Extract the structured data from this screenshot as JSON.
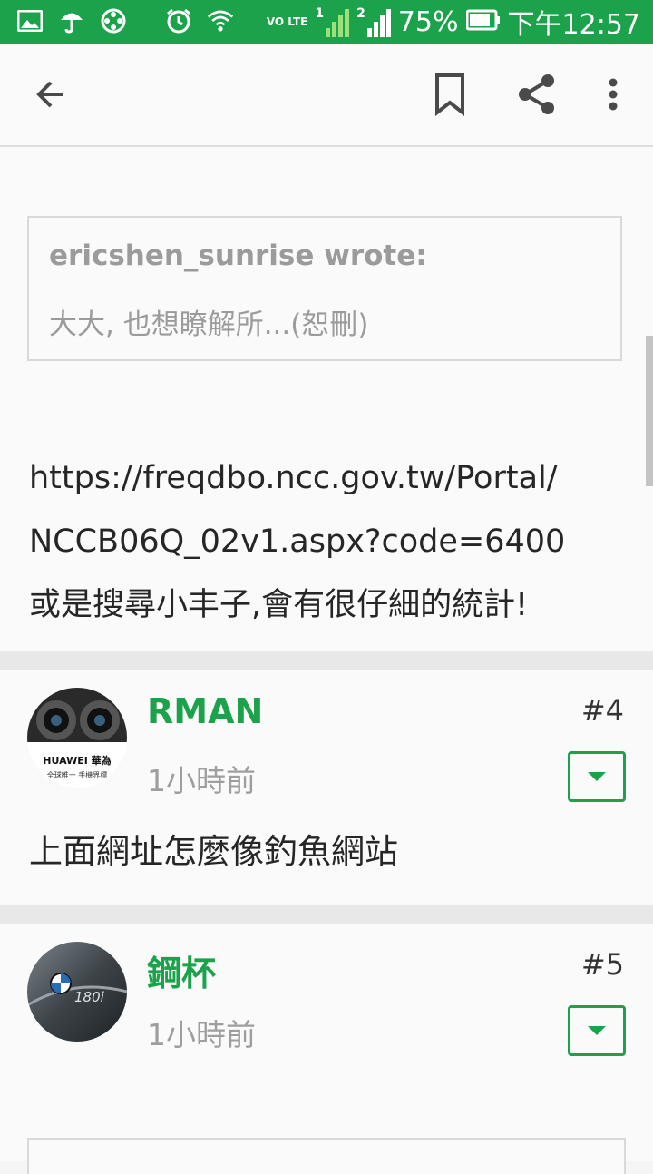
{
  "status_bar": {
    "battery": "75%",
    "time": "下午12:57",
    "network": "VO LTE",
    "sim1": "1",
    "sim2": "2",
    "icons": [
      "gallery-icon",
      "umbrella-icon",
      "film-icon",
      "alarm-icon",
      "wifi-icon",
      "signal-icon",
      "battery-icon"
    ]
  },
  "toolbar": {
    "back": "back-arrow-icon",
    "bookmark": "bookmark-icon",
    "share": "share-icon",
    "more": "more-vert-icon"
  },
  "quote": {
    "author": "ericshen_sunrise wrote:",
    "text": "大大, 也想瞭解所...(恕刪)"
  },
  "post3": {
    "body_line1": "https://freqdbo.ncc.gov.tw/Portal/",
    "body_line2": "NCCB06Q_02v1.aspx?code=6400",
    "body_line3": "或是搜尋小丰子,會有很仔細的統計!"
  },
  "post4": {
    "username": "RMAN",
    "time": "1小時前",
    "floor": "#4",
    "avatar_text1": "HUAWEI 華為",
    "avatar_text2": "全球唯一 手機界標",
    "body": "上面網址怎麼像釣魚網站"
  },
  "post5": {
    "username": "鋼杯",
    "time": "1小時前",
    "floor": "#5",
    "avatar_text": "180i"
  },
  "colors": {
    "accent": "#1ba24a",
    "text": "#262626",
    "muted": "#9e9e9e"
  }
}
